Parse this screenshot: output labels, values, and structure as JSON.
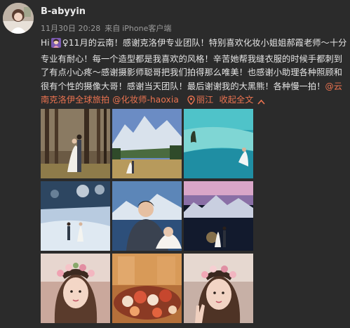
{
  "post": {
    "username": "B-abyyin",
    "date": "11月30日 20:28",
    "source_prefix": "来自",
    "source": "iPhone客户端",
    "text_lead": "Hi",
    "text_body": "♀11月的云南！感谢克洛伊专业团队！特别喜欢化妆小姐姐郝霞老师～十分专业有耐心！每一个造型都是我喜欢的风格！辛苦她帮我缝衣服的时候手都刺到了有点小心疼～感谢摄影师聪哥把我们拍得那么唯美！也感谢小助理各种照顾和很有个性的摄像大哥！感谢当天团队！最后谢谢我的大黑熊！各种慢一拍！",
    "mention_1": "@云南克洛伊全球旅拍",
    "mention_2": "@化妆师-haoxia",
    "location": "丽江",
    "collapse": "收起全文"
  },
  "colors": {
    "background": "#2b2b2b",
    "link": "#eb7350",
    "meta": "#9b9b9b"
  },
  "photos": [
    {
      "name": "photo-forest-couple"
    },
    {
      "name": "photo-snow-mountain-meadow"
    },
    {
      "name": "photo-turquoise-lake"
    },
    {
      "name": "photo-snowy-beach-couple"
    },
    {
      "name": "photo-groom-closeup"
    },
    {
      "name": "photo-night-mountain-couple"
    },
    {
      "name": "photo-flower-crown-portrait"
    },
    {
      "name": "photo-flower-arrangement"
    },
    {
      "name": "photo-flower-crown-peace-sign"
    }
  ]
}
